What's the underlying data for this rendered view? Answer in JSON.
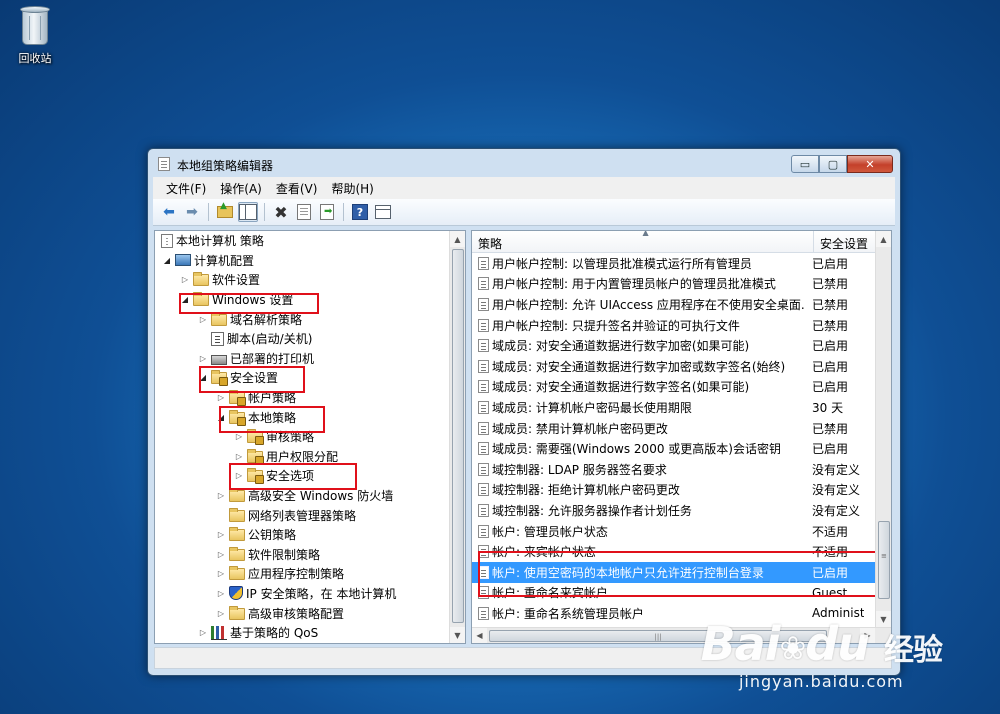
{
  "desktop": {
    "recycle_bin_label": "回收站"
  },
  "window": {
    "title": "本地组策略编辑器",
    "buttons": {
      "minimize": "▭",
      "maximize": "▢",
      "close": "✕"
    }
  },
  "menubar": [
    {
      "label": "文件(F)"
    },
    {
      "label": "操作(A)"
    },
    {
      "label": "查看(V)"
    },
    {
      "label": "帮助(H)"
    }
  ],
  "toolbar": {
    "back_icon": "back-arrow-icon",
    "forward_icon": "forward-arrow-icon",
    "buttons": [
      "up-one-level",
      "show-hide-tree",
      "delete",
      "properties",
      "export-list",
      "help",
      "show-hide-action-pane"
    ]
  },
  "tree": {
    "root": "本地计算机 策略",
    "computer_config": "计算机配置",
    "software_settings": "软件设置",
    "windows_settings": "Windows 设置",
    "dns_policy": "域名解析策略",
    "scripts": "脚本(启动/关机)",
    "deployed_printers": "已部署的打印机",
    "security_settings": "安全设置",
    "account_policies": "帐户策略",
    "local_policies": "本地策略",
    "audit_policy": "审核策略",
    "user_rights": "用户权限分配",
    "security_options": "安全选项",
    "firewall": "高级安全 Windows 防火墙",
    "network_list": "网络列表管理器策略",
    "public_key": "公钥策略",
    "software_restriction": "软件限制策略",
    "app_control": "应用程序控制策略",
    "ipsec": "IP 安全策略，在 本地计算机",
    "advanced_audit": "高级审核策略配置",
    "qos": "基于策略的 QoS"
  },
  "table": {
    "columns": {
      "policy": "策略",
      "setting": "安全设置"
    },
    "rows": [
      {
        "policy": "用户帐户控制: 以管理员批准模式运行所有管理员",
        "setting": "已启用"
      },
      {
        "policy": "用户帐户控制: 用于内置管理员帐户的管理员批准模式",
        "setting": "已禁用"
      },
      {
        "policy": "用户帐户控制: 允许 UIAccess 应用程序在不使用安全桌面...",
        "setting": "已禁用"
      },
      {
        "policy": "用户帐户控制: 只提升签名并验证的可执行文件",
        "setting": "已禁用"
      },
      {
        "policy": "域成员: 对安全通道数据进行数字加密(如果可能)",
        "setting": "已启用"
      },
      {
        "policy": "域成员: 对安全通道数据进行数字加密或数字签名(始终)",
        "setting": "已启用"
      },
      {
        "policy": "域成员: 对安全通道数据进行数字签名(如果可能)",
        "setting": "已启用"
      },
      {
        "policy": "域成员: 计算机帐户密码最长使用期限",
        "setting": "30 天"
      },
      {
        "policy": "域成员: 禁用计算机帐户密码更改",
        "setting": "已禁用"
      },
      {
        "policy": "域成员: 需要强(Windows 2000 或更高版本)会话密钥",
        "setting": "已启用"
      },
      {
        "policy": "域控制器: LDAP 服务器签名要求",
        "setting": "没有定义"
      },
      {
        "policy": "域控制器: 拒绝计算机帐户密码更改",
        "setting": "没有定义"
      },
      {
        "policy": "域控制器: 允许服务器操作者计划任务",
        "setting": "没有定义"
      },
      {
        "policy": "帐户: 管理员帐户状态",
        "setting": "不适用"
      },
      {
        "policy": "帐户: 来宾帐户状态",
        "setting": "不适用"
      },
      {
        "policy": "帐户: 使用空密码的本地帐户只允许进行控制台登录",
        "setting": "已启用",
        "selected": true
      },
      {
        "policy": "帐户: 重命名来宾帐户",
        "setting": "Guest"
      },
      {
        "policy": "帐户: 重命名系统管理员帐户",
        "setting": "Administr"
      }
    ]
  },
  "watermark": {
    "logo_text": "Bai",
    "logo_text2": "du",
    "logo_cn": "经验",
    "url": "jingyan.baidu.com"
  },
  "colors": {
    "selection": "#3399ff",
    "annotation": "#e0101a"
  }
}
